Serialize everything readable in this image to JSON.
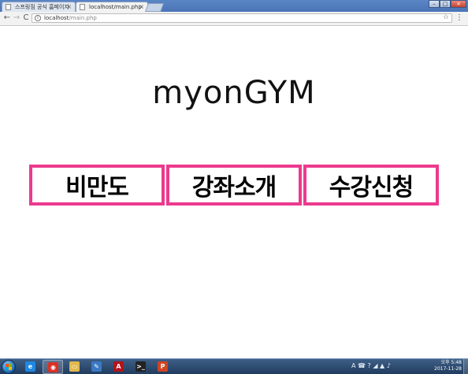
{
  "browser": {
    "tabs": [
      {
        "label": "스프링짐 공식 홈페이지",
        "active": false
      },
      {
        "label": "localhost/main.php",
        "active": true
      }
    ],
    "tab_close_glyph": "×",
    "address": {
      "host": "localhost",
      "path": "/main.php"
    },
    "nav": {
      "back": "←",
      "forward": "→",
      "reload": "C"
    },
    "icons": {
      "info": "i",
      "star": "☆",
      "menu": "⋮"
    },
    "window_buttons": {
      "minimize": "–",
      "maximize": "□",
      "close": "×"
    }
  },
  "page": {
    "title": "myonGYM",
    "menu": [
      {
        "label": "비만도"
      },
      {
        "label": "강좌소개"
      },
      {
        "label": "수강신청"
      }
    ],
    "accent_color": "#ec3a8e"
  },
  "taskbar": {
    "apps": [
      {
        "name": "ie-icon",
        "glyph": "e",
        "color": "#1e88e5"
      },
      {
        "name": "chrome-icon",
        "glyph": "◉",
        "color": "#d93025"
      },
      {
        "name": "folder-icon",
        "glyph": "▭",
        "color": "#e0b84c"
      },
      {
        "name": "app-icon",
        "glyph": "✎",
        "color": "#3b78c4"
      },
      {
        "name": "acrobat-icon",
        "glyph": "A",
        "color": "#b3121b"
      },
      {
        "name": "terminal-icon",
        "glyph": ">_",
        "color": "#222222"
      },
      {
        "name": "powerpoint-icon",
        "glyph": "P",
        "color": "#d04423"
      }
    ],
    "tray_icons": "A ☎ ? ◢ ▲ ♪",
    "clock": {
      "period_time": "오후 5:48",
      "date": "2017-11-28"
    }
  }
}
